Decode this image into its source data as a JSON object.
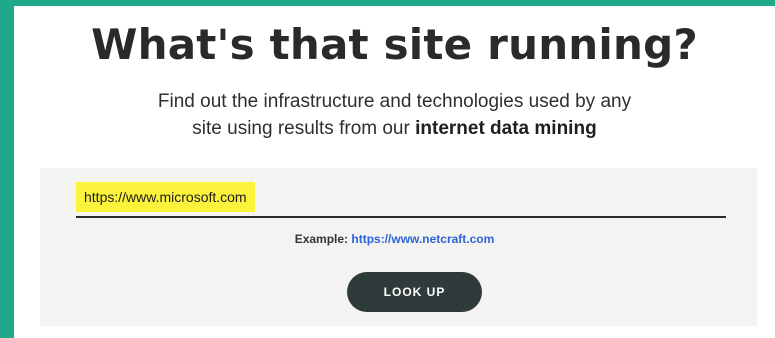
{
  "header": {
    "title": "What's that site running?",
    "subtitle_line1": "Find out the infrastructure and technologies used by any",
    "subtitle_line2_prefix": "site using results from our ",
    "subtitle_line2_bold": "internet data mining"
  },
  "search": {
    "value": "https://www.microsoft.com",
    "example_label": "Example:",
    "example_link": "https://www.netcraft.com",
    "button_label": "LOOK UP"
  },
  "colors": {
    "accent": "#1fa98a",
    "highlight": "#fbf23b",
    "button": "#2e3b3a",
    "link": "#2f64d6"
  }
}
